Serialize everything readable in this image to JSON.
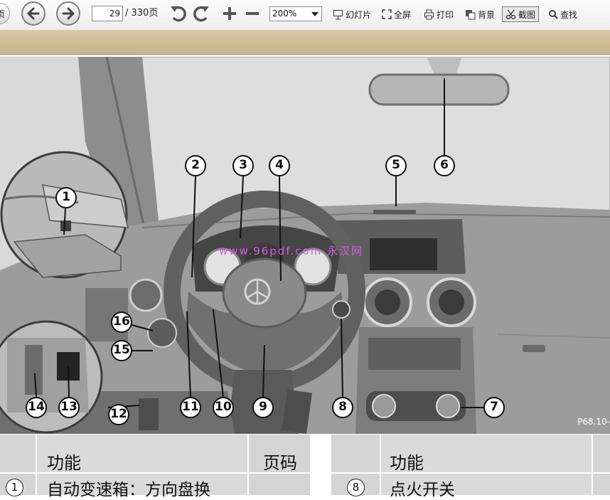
{
  "toolbar": {
    "page_suffix": "页",
    "current_page": "29",
    "total_pages": "/ 330页",
    "zoom": "200%",
    "slideshow_label": "幻灯片",
    "fullscreen_label": "全屏",
    "print_label": "打印",
    "background_label": "背景",
    "screenshot_label": "截图",
    "find_label": "查找"
  },
  "figure": {
    "watermark": "www.96pdf.com 永汉网",
    "figure_id": "P68.10-",
    "callouts": [
      "1",
      "2",
      "3",
      "4",
      "5",
      "6",
      "7",
      "8",
      "9",
      "10",
      "11",
      "12",
      "13",
      "14",
      "15",
      "16"
    ]
  },
  "table_left": {
    "col_function": "功能",
    "col_page": "页码",
    "rows": [
      {
        "num": "1",
        "function": "自动变速箱：方向盘换"
      }
    ]
  },
  "table_right": {
    "col_function": "功能",
    "rows": [
      {
        "num": "8",
        "function": "点火开关"
      }
    ]
  }
}
